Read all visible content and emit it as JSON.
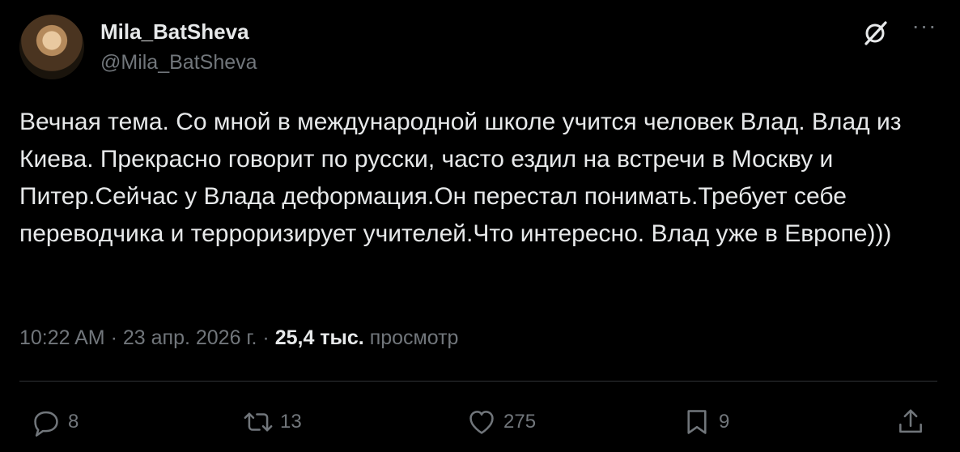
{
  "author": {
    "display_name": "Mila_BatSheva",
    "handle": "@Mila_BatSheva"
  },
  "tweet": {
    "text": "Вечная тема. Со мной в международной школе учится человек Влад. Влад из Киева. Прекрасно говорит по русски, часто ездил на встречи в Москву и Питер.Сейчас у Влада деформация.Он перестал понимать.Требует себе переводчика и терроризирует учителей.Что интересно. Влад уже в Европе)))"
  },
  "meta": {
    "time": "10:22 AM",
    "separator": "·",
    "date": "23 апр. 2026 г.",
    "views_count": "25,4 тыс.",
    "views_label": "просмотр"
  },
  "actions": {
    "replies": "8",
    "reposts": "13",
    "likes": "275",
    "bookmarks": "9"
  },
  "icons": {
    "grok": "grok-icon",
    "more": "more-icon",
    "reply": "reply-icon",
    "repost": "repost-icon",
    "like": "heart-icon",
    "bookmark": "bookmark-icon",
    "share": "share-icon"
  },
  "colors": {
    "background": "#000000",
    "text": "#e7e9ea",
    "muted": "#71767b",
    "divider": "#2f3336"
  }
}
